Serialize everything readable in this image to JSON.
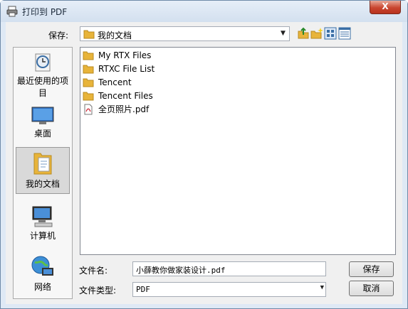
{
  "window": {
    "title": "打印到 PDF",
    "close_glyph": "X"
  },
  "toolbar": {
    "save_in_label": "保存:",
    "save_in_value": "我的文档",
    "icons": [
      "up-folder-icon",
      "new-folder-icon",
      "view-list-icon",
      "view-details-icon"
    ]
  },
  "places": [
    {
      "label": "最近使用的项目",
      "icon": "recent-icon"
    },
    {
      "label": "桌面",
      "icon": "desktop-icon"
    },
    {
      "label": "我的文档",
      "icon": "documents-icon",
      "selected": true
    },
    {
      "label": "计算机",
      "icon": "computer-icon"
    },
    {
      "label": "网络",
      "icon": "network-icon"
    }
  ],
  "files": [
    {
      "name": "My RTX Files",
      "type": "folder"
    },
    {
      "name": "RTXC File List",
      "type": "folder"
    },
    {
      "name": "Tencent",
      "type": "folder"
    },
    {
      "name": "Tencent Files",
      "type": "folder"
    },
    {
      "name": "全页照片.pdf",
      "type": "pdf"
    }
  ],
  "form": {
    "filename_label": "文件名:",
    "filename_value": "小薛教你做家装设计.pdf",
    "filetype_label": "文件类型:",
    "filetype_value": "PDF",
    "save_button": "保存",
    "cancel_button": "取消"
  },
  "colors": {
    "folder": "#e8b43a",
    "accent": "#3a6ea5",
    "close": "#c9452f"
  }
}
